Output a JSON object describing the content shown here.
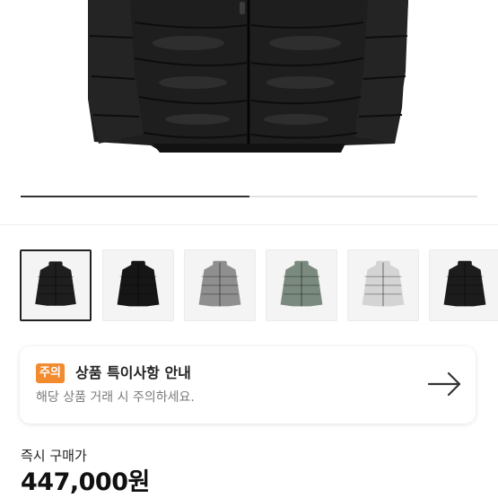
{
  "gallery": {
    "main_image_icon": "puffer-jacket-icon",
    "slide_progress_percent": 50,
    "thumbnails": [
      {
        "icon": "black-puffer-jacket-thumbnail",
        "color": "#1e1e1e",
        "selected": true
      },
      {
        "icon": "glossy-black-puffer-jacket-thumbnail",
        "color": "#161616",
        "selected": false
      },
      {
        "icon": "grey-puffer-jacket-thumbnail",
        "color": "#8f8f8f",
        "selected": false
      },
      {
        "icon": "green-puffer-jacket-thumbnail",
        "color": "#7b8a7e",
        "selected": false
      },
      {
        "icon": "silver-puffer-jacket-thumbnail",
        "color": "#d4d4d4",
        "selected": false
      },
      {
        "icon": "black-puffer-jacket-thumbnail-2",
        "color": "#1c1c1c",
        "selected": false
      }
    ]
  },
  "notice": {
    "badge": "주의",
    "title": "상품 특이사항 안내",
    "description": "해당 상품 거래 시 주의하세요.",
    "badge_color": "#f28a2e",
    "arrow_icon": "arrow-right-icon"
  },
  "purchase": {
    "label": "즉시 구매가",
    "price": "447,000원"
  }
}
